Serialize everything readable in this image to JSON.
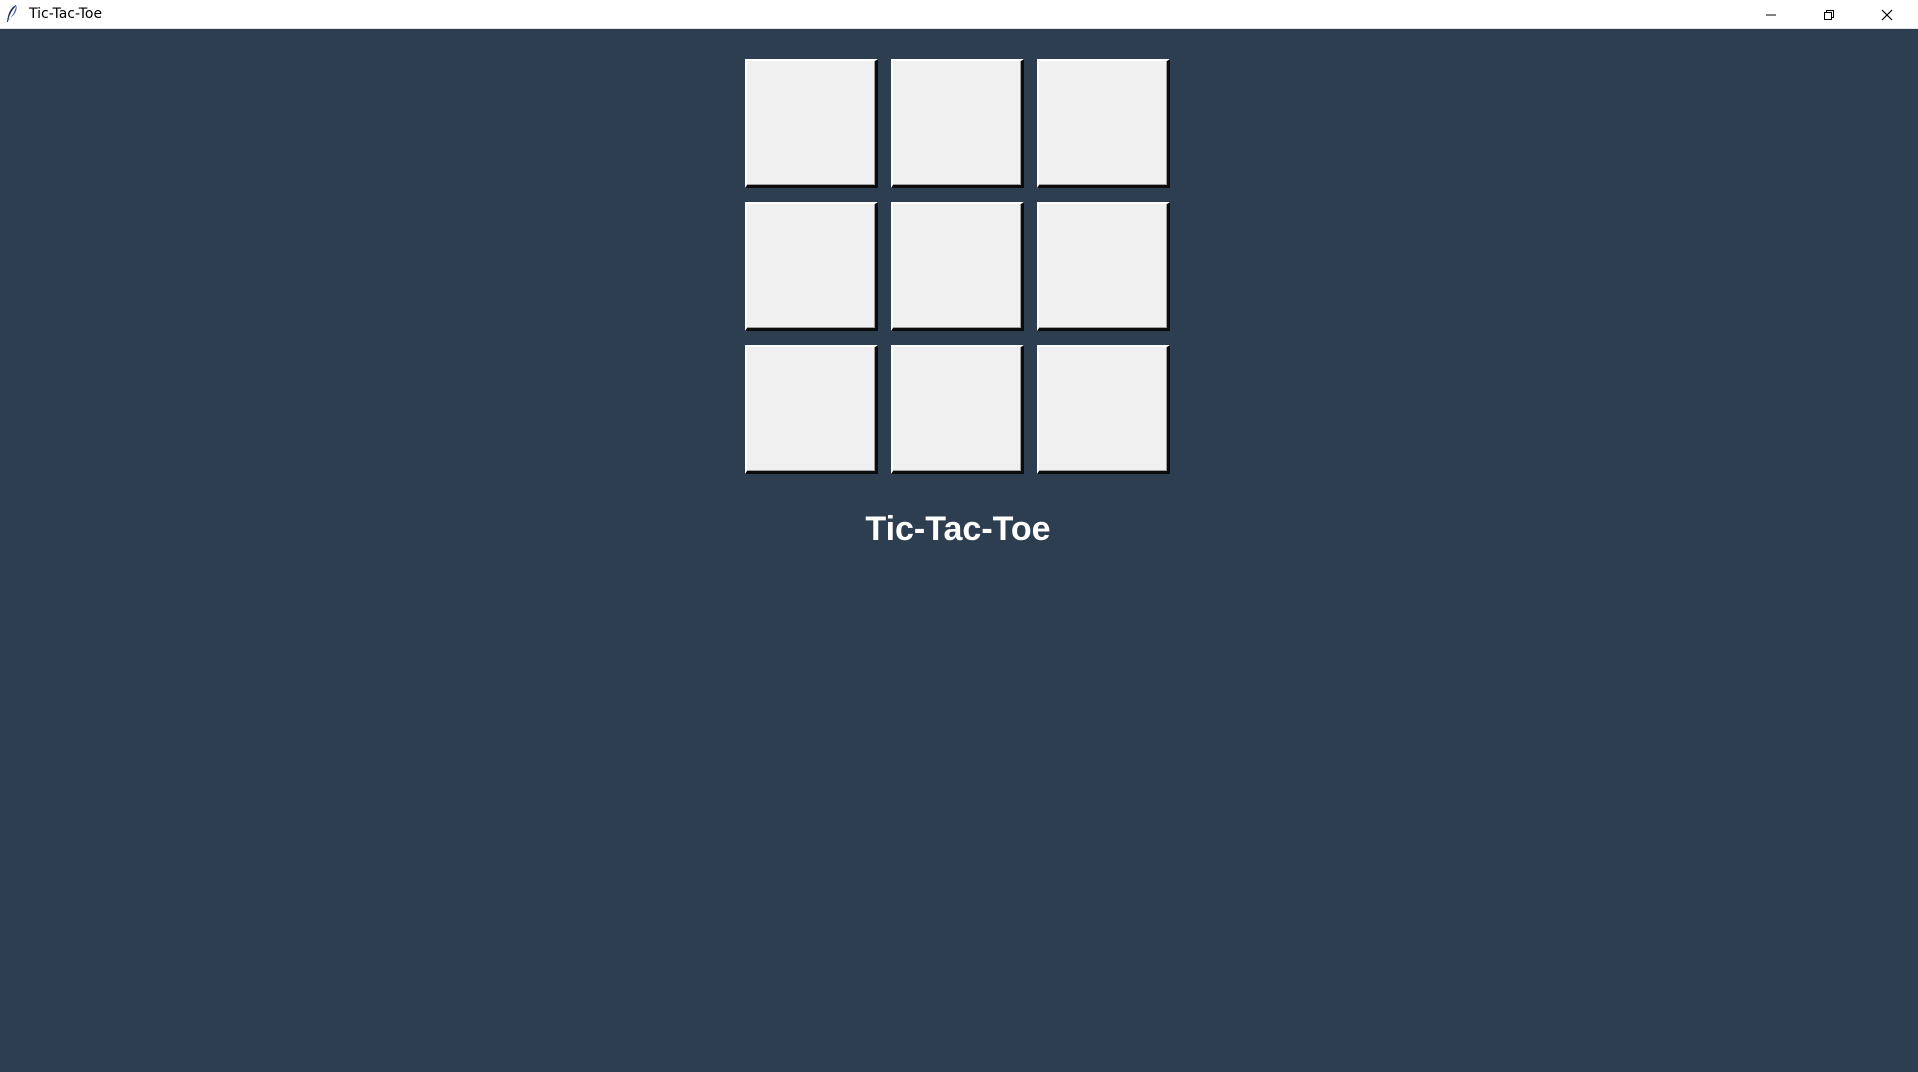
{
  "window": {
    "title": "Tic-Tac-Toe",
    "icon": "feather-icon",
    "controls": {
      "minimize_icon": "minimize-icon",
      "maximize_icon": "restore-icon",
      "close_icon": "close-icon"
    }
  },
  "colors": {
    "background": "#2d3e50",
    "cell": "#f0f0f0",
    "status_text": "#ffffff"
  },
  "board": {
    "rows": 3,
    "cols": 3,
    "cells": [
      "",
      "",
      "",
      "",
      "",
      "",
      "",
      "",
      ""
    ]
  },
  "status": {
    "text": "Tic-Tac-Toe"
  }
}
